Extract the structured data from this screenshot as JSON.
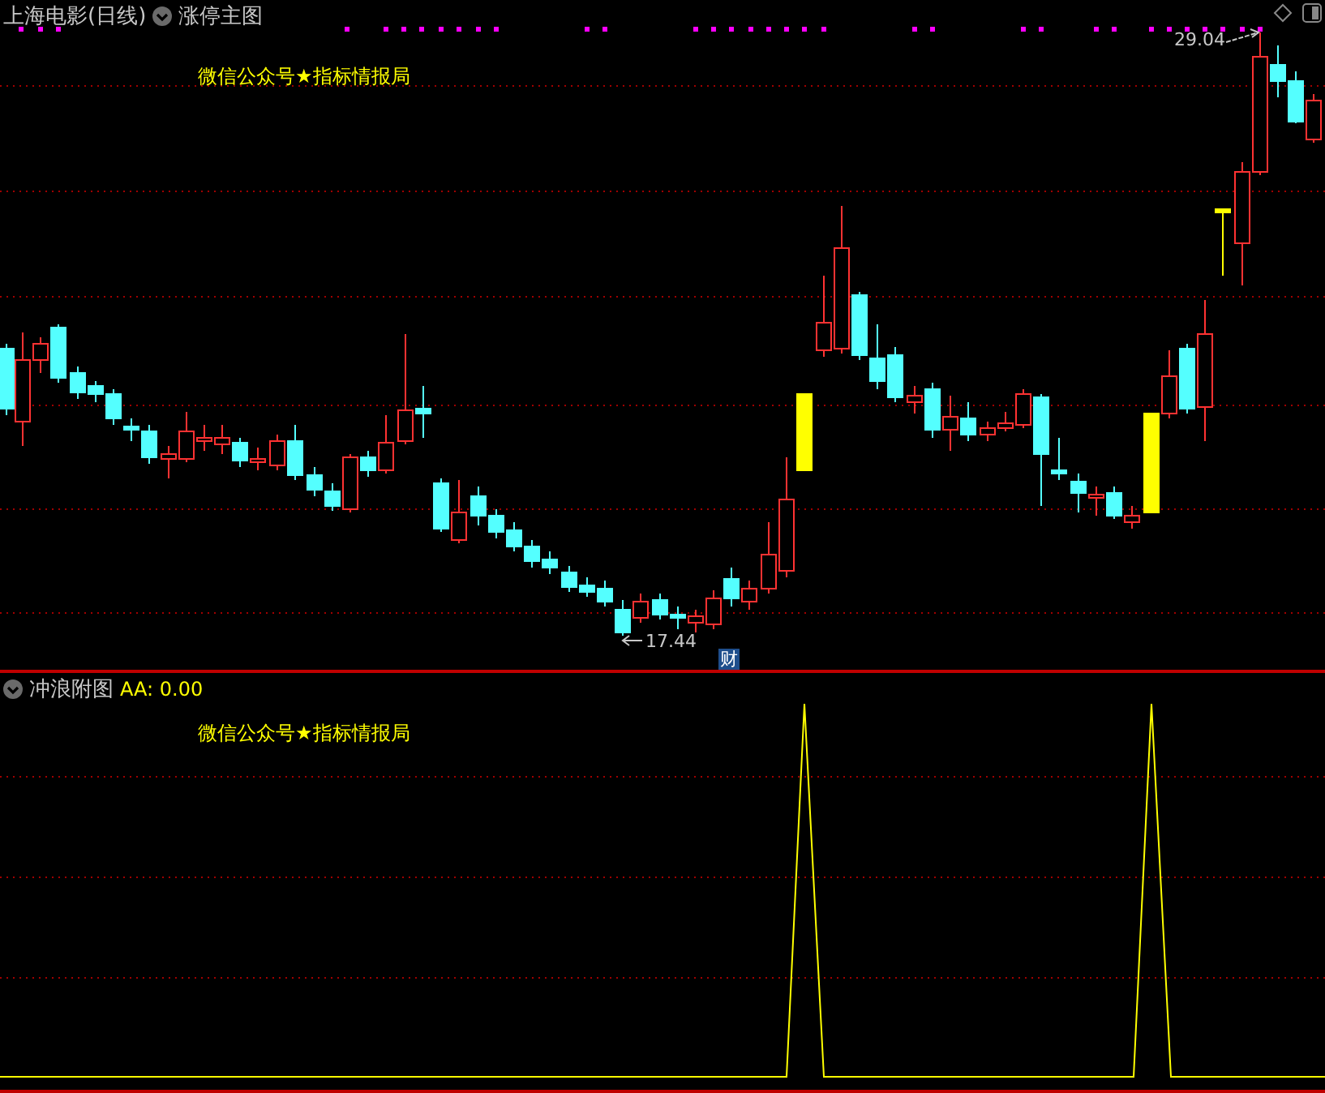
{
  "main_panel": {
    "title": "上海电影(日线)",
    "indicator": "涨停主图",
    "chart_text": "微信公众号★指标情报局",
    "high_label": "29.04",
    "low_label": "17.44",
    "badge": "财"
  },
  "sub_panel": {
    "indicator": "冲浪附图",
    "reading": "AA: 0.00",
    "chart_text": "微信公众号★指标情报局"
  }
}
